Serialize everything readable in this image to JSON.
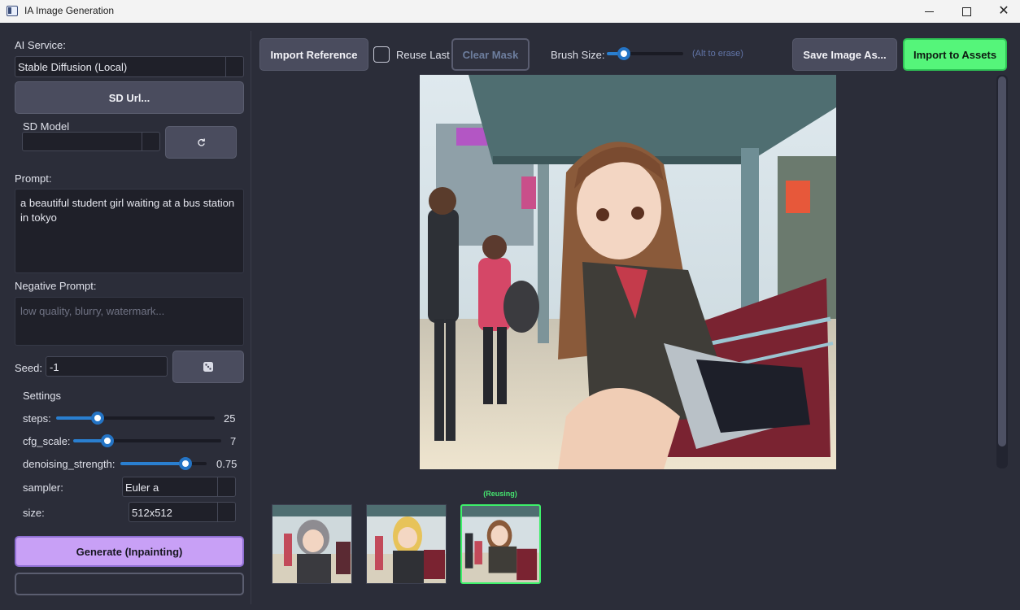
{
  "window": {
    "title": "IA Image Generation",
    "minimize_icon": "minimize-icon",
    "maximize_icon": "maximize-icon",
    "close_icon": "close-icon"
  },
  "sidebar": {
    "ai_service_label": "AI Service:",
    "ai_service_value": "Stable Diffusion (Local)",
    "sd_url_button": "SD Url...",
    "sd_model_label": "SD Model",
    "sd_model_value": "",
    "refresh_icon": "refresh-icon",
    "prompt_label": "Prompt:",
    "prompt_value": "a beautiful student girl waiting at a bus station in tokyo",
    "negative_prompt_label": "Negative Prompt:",
    "negative_prompt_placeholder": "low quality, blurry, watermark...",
    "seed_label": "Seed:",
    "seed_value": "-1",
    "dice_icon": "dice-icon",
    "settings_label": "Settings",
    "settings": {
      "steps": {
        "label": "steps:",
        "value": "25",
        "fraction": 0.26
      },
      "cfg_scale": {
        "label": "cfg_scale:",
        "value": "7",
        "fraction": 0.23
      },
      "denoising_strength": {
        "label": "denoising_strength:",
        "value": "0.75",
        "fraction": 0.75
      },
      "sampler": {
        "label": "sampler:",
        "value": "Euler a"
      },
      "size": {
        "label": "size:",
        "value": "512x512"
      }
    },
    "generate_button": "Generate (Inpainting)",
    "progress_text": ""
  },
  "toolbar": {
    "import_reference": "Import Reference",
    "reuse_last_label": "Reuse Last",
    "reuse_last_checked": false,
    "clear_mask": "Clear Mask",
    "brush_size_label": "Brush Size:",
    "brush_size_fraction": 0.22,
    "brush_hint": "(Alt to erase)",
    "save_image_as": "Save Image As...",
    "import_to_assets": "Import to Assets"
  },
  "gallery": {
    "reusing_label": "(Reusing)",
    "selected_index": 2
  },
  "colors": {
    "accent_purple": "#c8a0f6",
    "accent_green": "#55f57a",
    "slider_blue": "#2a7fd0",
    "background": "#2b2d39"
  }
}
